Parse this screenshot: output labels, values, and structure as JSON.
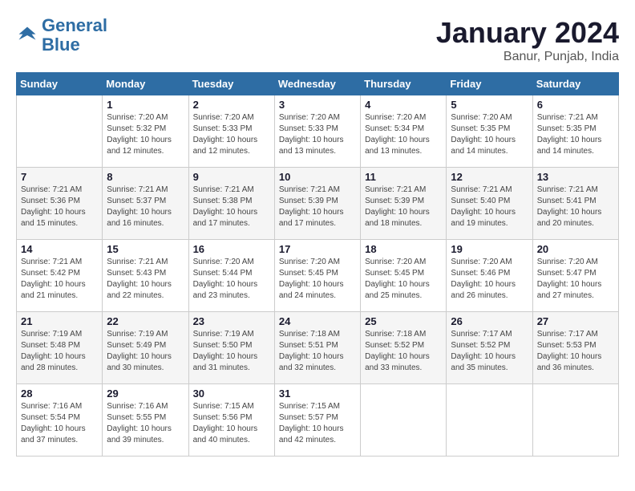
{
  "header": {
    "logo_line1": "General",
    "logo_line2": "Blue",
    "month": "January 2024",
    "location": "Banur, Punjab, India"
  },
  "days_of_week": [
    "Sunday",
    "Monday",
    "Tuesday",
    "Wednesday",
    "Thursday",
    "Friday",
    "Saturday"
  ],
  "weeks": [
    [
      {
        "day": "",
        "info": ""
      },
      {
        "day": "1",
        "info": "Sunrise: 7:20 AM\nSunset: 5:32 PM\nDaylight: 10 hours\nand 12 minutes."
      },
      {
        "day": "2",
        "info": "Sunrise: 7:20 AM\nSunset: 5:33 PM\nDaylight: 10 hours\nand 12 minutes."
      },
      {
        "day": "3",
        "info": "Sunrise: 7:20 AM\nSunset: 5:33 PM\nDaylight: 10 hours\nand 13 minutes."
      },
      {
        "day": "4",
        "info": "Sunrise: 7:20 AM\nSunset: 5:34 PM\nDaylight: 10 hours\nand 13 minutes."
      },
      {
        "day": "5",
        "info": "Sunrise: 7:20 AM\nSunset: 5:35 PM\nDaylight: 10 hours\nand 14 minutes."
      },
      {
        "day": "6",
        "info": "Sunrise: 7:21 AM\nSunset: 5:35 PM\nDaylight: 10 hours\nand 14 minutes."
      }
    ],
    [
      {
        "day": "7",
        "info": "Sunrise: 7:21 AM\nSunset: 5:36 PM\nDaylight: 10 hours\nand 15 minutes."
      },
      {
        "day": "8",
        "info": "Sunrise: 7:21 AM\nSunset: 5:37 PM\nDaylight: 10 hours\nand 16 minutes."
      },
      {
        "day": "9",
        "info": "Sunrise: 7:21 AM\nSunset: 5:38 PM\nDaylight: 10 hours\nand 17 minutes."
      },
      {
        "day": "10",
        "info": "Sunrise: 7:21 AM\nSunset: 5:39 PM\nDaylight: 10 hours\nand 17 minutes."
      },
      {
        "day": "11",
        "info": "Sunrise: 7:21 AM\nSunset: 5:39 PM\nDaylight: 10 hours\nand 18 minutes."
      },
      {
        "day": "12",
        "info": "Sunrise: 7:21 AM\nSunset: 5:40 PM\nDaylight: 10 hours\nand 19 minutes."
      },
      {
        "day": "13",
        "info": "Sunrise: 7:21 AM\nSunset: 5:41 PM\nDaylight: 10 hours\nand 20 minutes."
      }
    ],
    [
      {
        "day": "14",
        "info": "Sunrise: 7:21 AM\nSunset: 5:42 PM\nDaylight: 10 hours\nand 21 minutes."
      },
      {
        "day": "15",
        "info": "Sunrise: 7:21 AM\nSunset: 5:43 PM\nDaylight: 10 hours\nand 22 minutes."
      },
      {
        "day": "16",
        "info": "Sunrise: 7:20 AM\nSunset: 5:44 PM\nDaylight: 10 hours\nand 23 minutes."
      },
      {
        "day": "17",
        "info": "Sunrise: 7:20 AM\nSunset: 5:45 PM\nDaylight: 10 hours\nand 24 minutes."
      },
      {
        "day": "18",
        "info": "Sunrise: 7:20 AM\nSunset: 5:45 PM\nDaylight: 10 hours\nand 25 minutes."
      },
      {
        "day": "19",
        "info": "Sunrise: 7:20 AM\nSunset: 5:46 PM\nDaylight: 10 hours\nand 26 minutes."
      },
      {
        "day": "20",
        "info": "Sunrise: 7:20 AM\nSunset: 5:47 PM\nDaylight: 10 hours\nand 27 minutes."
      }
    ],
    [
      {
        "day": "21",
        "info": "Sunrise: 7:19 AM\nSunset: 5:48 PM\nDaylight: 10 hours\nand 28 minutes."
      },
      {
        "day": "22",
        "info": "Sunrise: 7:19 AM\nSunset: 5:49 PM\nDaylight: 10 hours\nand 30 minutes."
      },
      {
        "day": "23",
        "info": "Sunrise: 7:19 AM\nSunset: 5:50 PM\nDaylight: 10 hours\nand 31 minutes."
      },
      {
        "day": "24",
        "info": "Sunrise: 7:18 AM\nSunset: 5:51 PM\nDaylight: 10 hours\nand 32 minutes."
      },
      {
        "day": "25",
        "info": "Sunrise: 7:18 AM\nSunset: 5:52 PM\nDaylight: 10 hours\nand 33 minutes."
      },
      {
        "day": "26",
        "info": "Sunrise: 7:17 AM\nSunset: 5:52 PM\nDaylight: 10 hours\nand 35 minutes."
      },
      {
        "day": "27",
        "info": "Sunrise: 7:17 AM\nSunset: 5:53 PM\nDaylight: 10 hours\nand 36 minutes."
      }
    ],
    [
      {
        "day": "28",
        "info": "Sunrise: 7:16 AM\nSunset: 5:54 PM\nDaylight: 10 hours\nand 37 minutes."
      },
      {
        "day": "29",
        "info": "Sunrise: 7:16 AM\nSunset: 5:55 PM\nDaylight: 10 hours\nand 39 minutes."
      },
      {
        "day": "30",
        "info": "Sunrise: 7:15 AM\nSunset: 5:56 PM\nDaylight: 10 hours\nand 40 minutes."
      },
      {
        "day": "31",
        "info": "Sunrise: 7:15 AM\nSunset: 5:57 PM\nDaylight: 10 hours\nand 42 minutes."
      },
      {
        "day": "",
        "info": ""
      },
      {
        "day": "",
        "info": ""
      },
      {
        "day": "",
        "info": ""
      }
    ]
  ]
}
